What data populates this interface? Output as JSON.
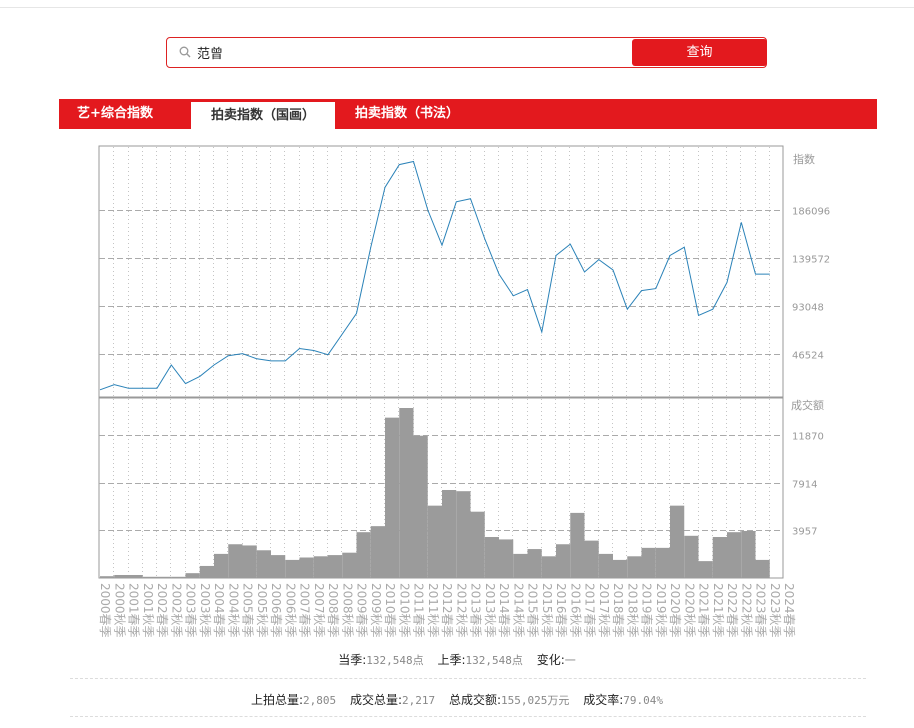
{
  "search": {
    "value": "范曾",
    "button_label": "查询"
  },
  "tabs": [
    {
      "label": "艺+综合指数",
      "active": false
    },
    {
      "label": "拍卖指数（国画）",
      "active": true
    },
    {
      "label": "拍卖指数（书法）",
      "active": false
    }
  ],
  "chart_data": [
    {
      "type": "line",
      "ylabel": "指数",
      "yticks": [
        46524,
        93048,
        139572,
        186096
      ],
      "x": [
        "2000春季",
        "2000秋季",
        "2001春季",
        "2001秋季",
        "2002春季",
        "2002秋季",
        "2003春季",
        "2003秋季",
        "2004春季",
        "2004秋季",
        "2005春季",
        "2005秋季",
        "2006春季",
        "2006秋季",
        "2007春季",
        "2007秋季",
        "2008春季",
        "2008秋季",
        "2009春季",
        "2009秋季",
        "2010春季",
        "2010秋季",
        "2011春季",
        "2011秋季",
        "2012春季",
        "2012秋季",
        "2013春季",
        "2013秋季",
        "2014春季",
        "2014秋季",
        "2015春季",
        "2015秋季",
        "2016春季",
        "2016秋季",
        "2017春季",
        "2017秋季",
        "2018春季",
        "2018秋季",
        "2019春季",
        "2019秋季",
        "2020春季",
        "2020秋季",
        "2021春季",
        "2021秋季",
        "2022春季",
        "2022秋季",
        "2023春季",
        "2023秋季",
        "2024春季"
      ],
      "values": [
        12000,
        17000,
        13500,
        13500,
        13500,
        36000,
        18000,
        25000,
        36000,
        45000,
        47000,
        42000,
        40000,
        40000,
        52000,
        50000,
        46000,
        66000,
        86000,
        150000,
        208000,
        230000,
        233000,
        186000,
        152000,
        194000,
        197000,
        158000,
        124000,
        103000,
        109000,
        68000,
        142000,
        153000,
        126000,
        138000,
        128000,
        90000,
        108000,
        110000,
        142000,
        150000,
        84000,
        90000,
        116000,
        174000,
        124000,
        124000
      ],
      "color": "#2a82b8"
    },
    {
      "type": "bar",
      "ylabel": "成交额",
      "yticks": [
        3957,
        7914,
        11870
      ],
      "values": [
        150,
        250,
        250,
        100,
        100,
        100,
        400,
        1000,
        2000,
        2800,
        2700,
        2300,
        1900,
        1500,
        1700,
        1800,
        1900,
        2100,
        3800,
        4300,
        13300,
        14100,
        11800,
        6000,
        7300,
        7200,
        5500,
        3400,
        3200,
        2000,
        2400,
        1800,
        2800,
        5400,
        3100,
        2000,
        1500,
        1800,
        2500,
        2500,
        6000,
        3500,
        1400,
        3400,
        3800,
        3900,
        1500
      ]
    }
  ],
  "stats": {
    "current_label": "当季:",
    "current_value": "132,548点",
    "last_label": "上季:",
    "last_value": "132,548点",
    "change_label": "变化:",
    "change_value": "一",
    "listed_label": "上拍总量:",
    "listed_value": "2,805",
    "sold_label": "成交总量:",
    "sold_value": "2,217",
    "turnover_label": "总成交额:",
    "turnover_value": "155,025万元",
    "rate_label": "成交率:",
    "rate_value": "79.04%"
  },
  "colors": {
    "accent": "#e3191e",
    "bar": "#9b9b9b",
    "line": "#2a82b8"
  }
}
